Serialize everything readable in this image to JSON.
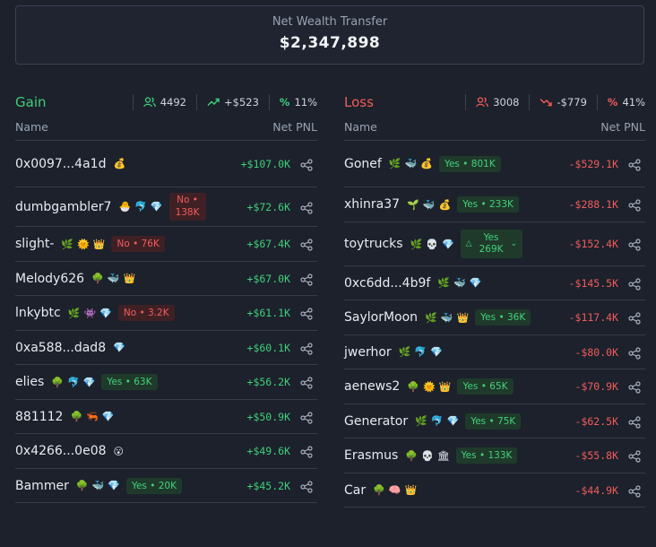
{
  "summary": {
    "title": "Net Wealth Transfer",
    "value": "$2,347,898"
  },
  "gain": {
    "title": "Gain",
    "stats": {
      "users": "4492",
      "change": "+$523",
      "percent": "11%"
    },
    "col_name": "Name",
    "col_pnl": "Net PNL",
    "rows": [
      {
        "name": "0x0097...4a1d",
        "badges": [
          "💰"
        ],
        "pnl": "+$107.0K"
      },
      {
        "name": "dumbgambler7",
        "badges": [
          "🐣",
          "🐬",
          "💎"
        ],
        "pill": "No • 138K",
        "pill_type": "no",
        "pill_l1": "No •",
        "pill_l2": "138K",
        "pnl": "+$72.6K"
      },
      {
        "name": "slight-",
        "badges": [
          "🌿",
          "🌞",
          "👑"
        ],
        "pill": "No • 76K",
        "pill_type": "no",
        "pnl": "+$67.4K"
      },
      {
        "name": "Melody626",
        "badges": [
          "🌳",
          "🐳",
          "👑"
        ],
        "pnl": "+$67.0K"
      },
      {
        "name": "lnkybtc",
        "badges": [
          "🌿",
          "👾",
          "💎"
        ],
        "pill": "No • 3.2K",
        "pill_type": "no",
        "pnl": "+$61.1K"
      },
      {
        "name": "0xa588...dad8",
        "badges": [
          "💎"
        ],
        "pnl": "+$60.1K"
      },
      {
        "name": "elies",
        "badges": [
          "🌳",
          "🐬",
          "💎"
        ],
        "pill": "Yes • 63K",
        "pill_type": "yes",
        "pnl": "+$56.2K"
      },
      {
        "name": "881112",
        "badges": [
          "🌳",
          "🦐",
          "💎"
        ],
        "pnl": "+$50.9K"
      },
      {
        "name": "0x4266...0e08",
        "badges": [
          "😮"
        ],
        "pnl": "+$49.6K"
      },
      {
        "name": "Bammer",
        "badges": [
          "🌳",
          "🐳",
          "💎"
        ],
        "pill": "Yes • 20K",
        "pill_type": "yes",
        "pnl": "+$45.2K"
      }
    ]
  },
  "loss": {
    "title": "Loss",
    "stats": {
      "users": "3008",
      "change": "-$779",
      "percent": "41%"
    },
    "col_name": "Name",
    "col_pnl": "Net PNL",
    "rows": [
      {
        "name": "Gonef",
        "badges": [
          "🌿",
          "🐳",
          "💰"
        ],
        "pill": "Yes • 801K",
        "pill_type": "yes",
        "pnl": "-$529.1K"
      },
      {
        "name": "xhinra37",
        "badges": [
          "🌱",
          "🐳",
          "💰"
        ],
        "pill": "Yes • 233K",
        "pill_type": "yes",
        "pnl": "-$288.1K"
      },
      {
        "name": "toytrucks",
        "badges": [
          "🌿",
          "💀",
          "💎"
        ],
        "pill": "Yes • 269K",
        "pill_type": "yes",
        "pill_l1": "Yes",
        "pill_l2": "269K",
        "pnl": "-$152.4K"
      },
      {
        "name": "0xc6dd...4b9f",
        "badges": [
          "🌿",
          "🐳",
          "💎"
        ],
        "pnl": "-$145.5K"
      },
      {
        "name": "SaylorMoon",
        "badges": [
          "🌿",
          "🐳",
          "👑"
        ],
        "pill": "Yes • 36K",
        "pill_type": "yes",
        "pnl": "-$117.4K"
      },
      {
        "name": "jwerhor",
        "badges": [
          "🌿",
          "🐬",
          "💎"
        ],
        "pnl": "-$80.0K"
      },
      {
        "name": "aenews2",
        "badges": [
          "🌳",
          "🌞",
          "👑"
        ],
        "pill": "Yes • 65K",
        "pill_type": "yes",
        "pnl": "-$70.9K"
      },
      {
        "name": "Generator",
        "badges": [
          "🌿",
          "🐬",
          "💎"
        ],
        "pill": "Yes • 75K",
        "pill_type": "yes",
        "pnl": "-$62.5K"
      },
      {
        "name": "Erasmus",
        "badges": [
          "🌳",
          "💀",
          "🏛"
        ],
        "pill": "Yes • 133K",
        "pill_type": "yes",
        "pnl": "-$55.8K"
      },
      {
        "name": "Car",
        "badges": [
          "🌳",
          "🧠",
          "👑"
        ],
        "pnl": "-$44.9K"
      }
    ]
  },
  "colors": {
    "gain": "#3fcf7a",
    "loss": "#f25b5b",
    "background": "#1c212c",
    "border": "#353c49"
  }
}
